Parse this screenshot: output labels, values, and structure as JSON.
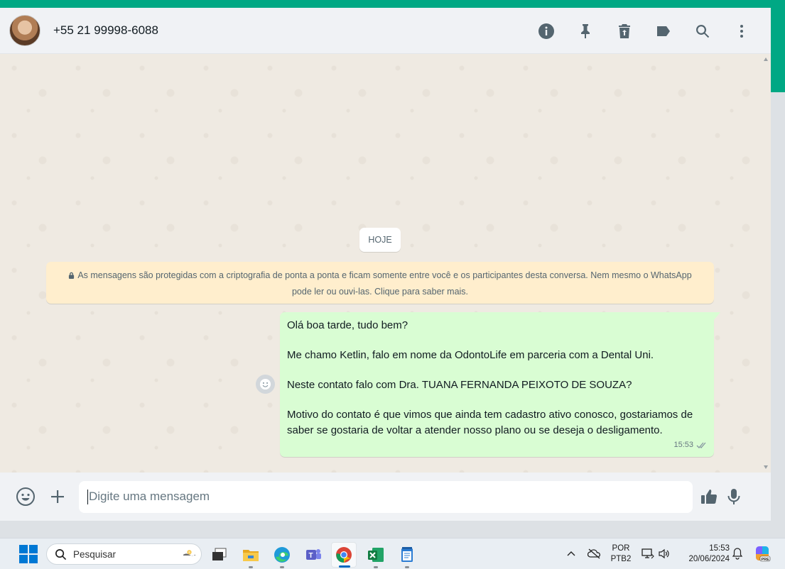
{
  "window": {
    "accent_color": "#00a884",
    "outgoing_bubble_color": "#d9fdd3",
    "notice_color": "#ffeecd"
  },
  "header": {
    "contact_name": "+55 21 99998-6088",
    "icons": [
      "info-icon",
      "pin-icon",
      "trash-icon",
      "label-icon",
      "search-icon",
      "more-vertical-icon"
    ]
  },
  "chat": {
    "day_separator": "HOJE",
    "encryption_notice": "As mensagens são protegidas com a criptografia de ponta a ponta e ficam somente entre você e os participantes desta conversa. Nem mesmo o WhatsApp pode ler ou ouvi-las. Clique para saber mais.",
    "messages": [
      {
        "direction": "outgoing",
        "lines": [
          "Olá boa tarde, tudo bem?",
          "Me chamo Ketlin, falo em nome da OdontoLife em parceria com a Dental Uni.",
          "Neste contato falo com Dra. TUANA FERNANDA PEIXOTO DE SOUZA?",
          "Motivo do contato é que vimos que ainda tem cadastro ativo conosco, gostariamos de saber se gostaria de voltar a atender nosso plano ou se deseja o desligamento."
        ],
        "time": "15:53",
        "status": "delivered"
      }
    ]
  },
  "composer": {
    "placeholder": "Digite uma mensagem",
    "value": ""
  },
  "taskbar": {
    "search_label": "Pesquisar",
    "apps": [
      "task-view",
      "file-explorer",
      "edge",
      "teams",
      "chrome",
      "excel",
      "notepad"
    ],
    "active_app": "chrome",
    "language_line1": "POR",
    "language_line2": "PTB2",
    "time": "15:53",
    "date": "20/06/2024"
  }
}
